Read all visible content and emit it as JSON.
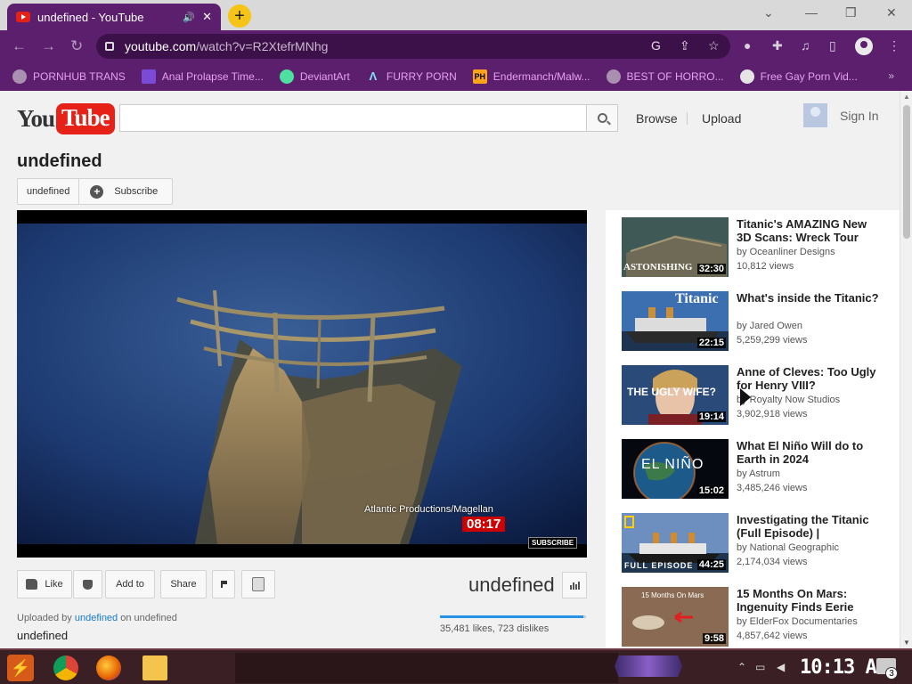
{
  "browser": {
    "tab_title": "undefined - YouTube",
    "tab_audio": "🔊",
    "tab_close": "✕",
    "new_tab": "+",
    "url_host": "youtube.com",
    "url_path": "/watch?v=R2XtefrMNhg",
    "minimize": "—",
    "restore": "❐",
    "close": "✕",
    "tab_search": "⌄",
    "back": "←",
    "forward": "→",
    "reload": "↻",
    "bookmarks_more": "»",
    "accent_color": "#5b1f6d"
  },
  "bookmarks": [
    {
      "label": "PORNHUB TRANS",
      "icon": "globe-icon"
    },
    {
      "label": "Anal Prolapse Time...",
      "icon": "sigma-icon"
    },
    {
      "label": "DeviantArt",
      "icon": "deviantart-icon"
    },
    {
      "label": "FURRY PORN",
      "icon": "a-logo-icon"
    },
    {
      "label": "Endermanch/Malw...",
      "icon": "ph-icon"
    },
    {
      "label": "BEST OF HORRO...",
      "icon": "globe-icon"
    },
    {
      "label": "Free Gay Porn Vid...",
      "icon": "mascot-icon"
    }
  ],
  "header": {
    "logo_you": "You",
    "logo_tube": "Tube",
    "search_placeholder": "",
    "browse": "Browse",
    "upload": "Upload",
    "sign_in": "Sign In"
  },
  "video": {
    "title": "undefined",
    "channel": "undefined",
    "subscribe": "Subscribe",
    "credit": "Atlantic Productions/Magellan",
    "timer": "08:17",
    "subscribe_badge": "SUBSCRIBE",
    "like": "Like",
    "add_to": "Add to",
    "share": "Share",
    "views_title": "undefined",
    "likes_text": "35,481 likes, 723 dislikes",
    "like_ratio": 0.98,
    "uploaded_prefix": "Uploaded by",
    "uploaded_by": "undefined",
    "uploaded_on": "on undefined",
    "description": "undefined"
  },
  "recommendations": [
    {
      "title": "Titanic's AMAZING New 3D Scans: Wreck Tour",
      "by": "by Oceanliner Designs",
      "views": "10,812 views",
      "duration": "32:30",
      "overlay": "ASTONISHING"
    },
    {
      "title": "What's inside the Titanic?",
      "by": "by Jared Owen",
      "views": "5,259,299 views",
      "duration": "22:15",
      "overlay": "Titanic"
    },
    {
      "title": "Anne of Cleves: Too Ugly for Henry VIII?",
      "by": "by Royalty Now Studios",
      "views": "3,902,918 views",
      "duration": "19:14",
      "overlay": "THE UGLY WIFE?"
    },
    {
      "title": "What El Niño Will do to Earth in 2024",
      "by": "by Astrum",
      "views": "3,485,246 views",
      "duration": "15:02",
      "overlay": "EL NIÑO"
    },
    {
      "title": "Investigating the Titanic (Full Episode) |",
      "by": "by National Geographic",
      "views": "2,174,034 views",
      "duration": "44:25",
      "overlay": "FULL EPISODE"
    },
    {
      "title": "15 Months On Mars: Ingenuity Finds Eerie",
      "by": "by ElderFox Documentaries",
      "views": "4,857,642 views",
      "duration": "9:58",
      "overlay": "15 Months On Mars"
    }
  ],
  "taskbar": {
    "clock": "10:13 AM",
    "notifications": "3"
  }
}
